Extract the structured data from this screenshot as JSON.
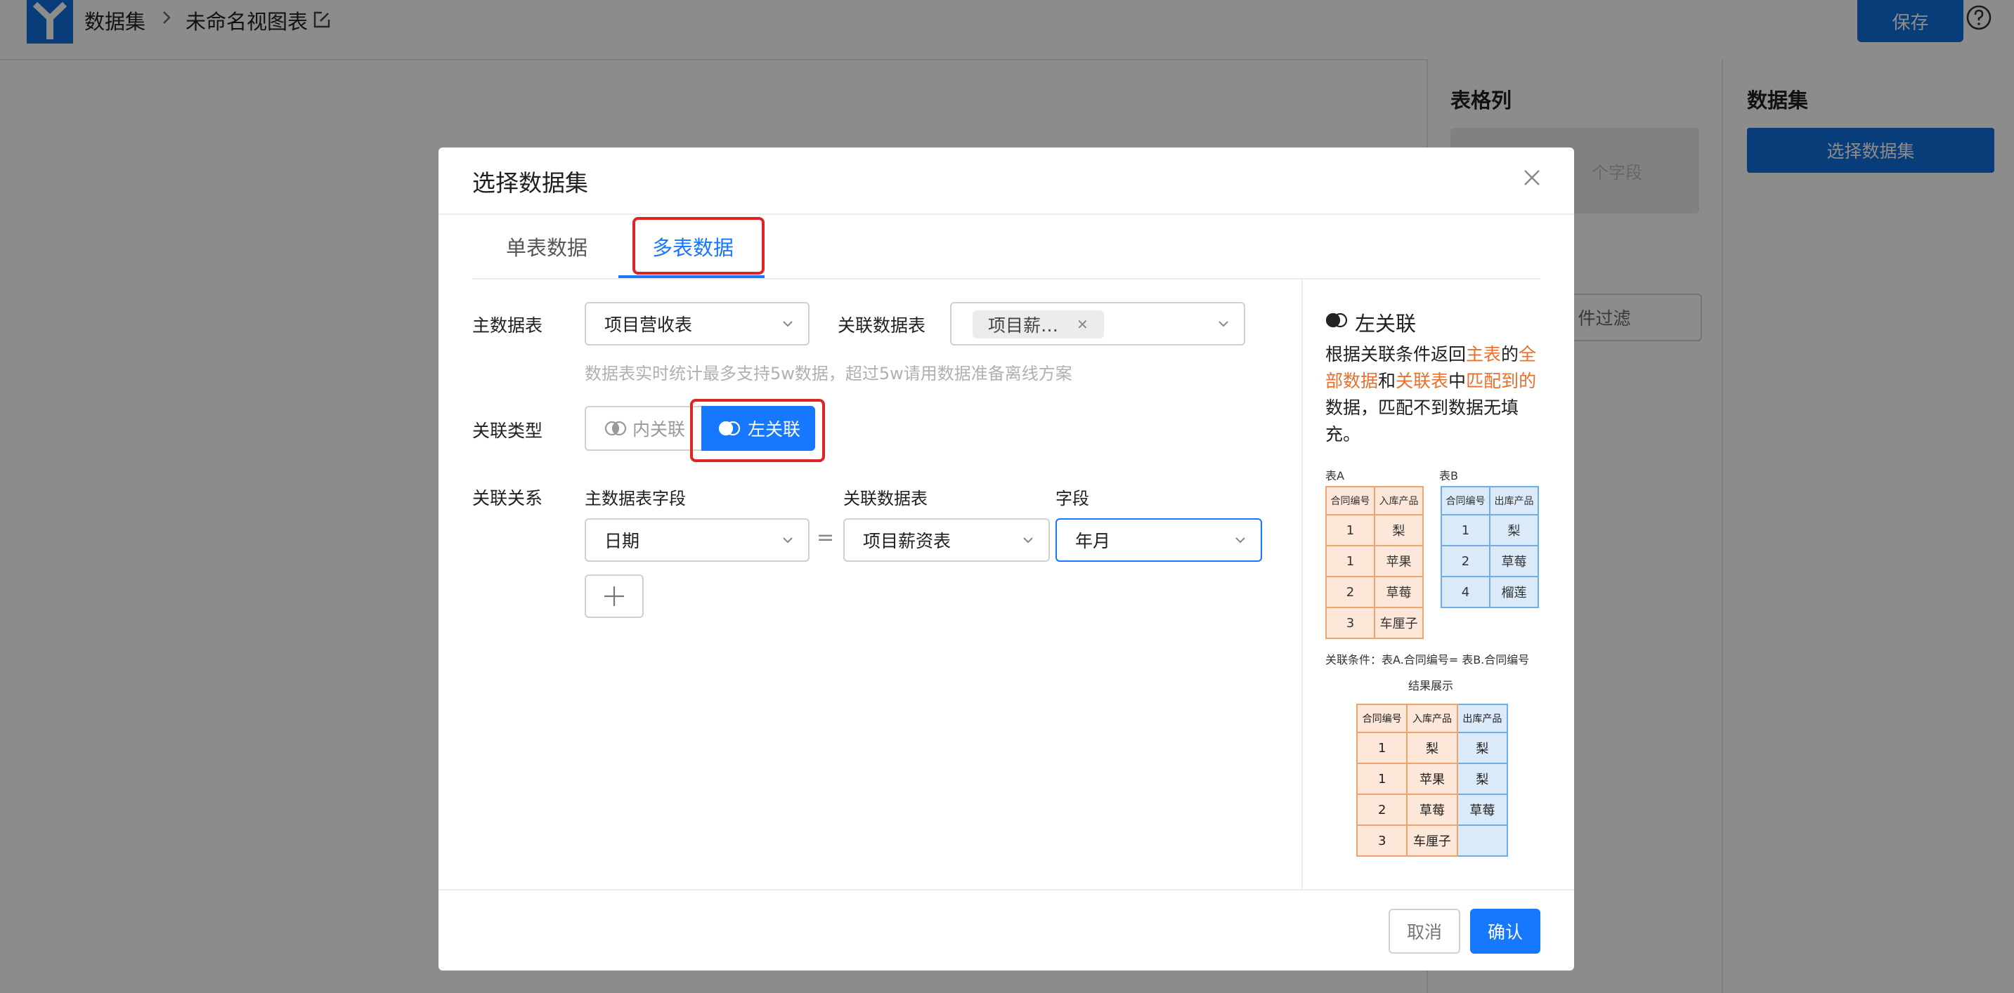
{
  "app": {
    "breadcrumb": [
      "数据集",
      "未命名视图表"
    ],
    "save_label": "保存",
    "colors": {
      "primary": "#1677ff",
      "save": "#0f6fdf",
      "highlight": "#e8702a",
      "annotation": "#e02424"
    }
  },
  "background_panels": {
    "table_columns_title": "表格列",
    "drop_placeholder": "个字段",
    "filter_label": "件过滤",
    "dataset_title": "数据集",
    "choose_dataset_label": "选择数据集"
  },
  "modal": {
    "title": "选择数据集",
    "tabs": [
      {
        "label": "单表数据",
        "active": false
      },
      {
        "label": "多表数据",
        "active": true
      }
    ],
    "main_table_label": "主数据表",
    "main_table_value": "项目营收表",
    "related_table_label": "关联数据表",
    "related_table_tag": "项目薪…",
    "hint": "数据表实时统计最多支持5w数据，超过5w请用数据准备离线方案",
    "join_type_label": "关联类型",
    "join_types": [
      {
        "label": "内关联",
        "selected": false
      },
      {
        "label": "左关联",
        "selected": true
      }
    ],
    "relation_label": "关联关系",
    "relation_headers": {
      "main_field": "主数据表字段",
      "related_table": "关联数据表",
      "field": "字段"
    },
    "relation_row": {
      "main_field": "日期",
      "operator": "=",
      "related_table": "项目薪资表",
      "field": "年月"
    },
    "cancel_label": "取消",
    "confirm_label": "确认"
  },
  "info_panel": {
    "title": "左关联",
    "desc": {
      "p1": "根据关联条件返回",
      "h1": "主表",
      "p2": "的",
      "h2": "全部数据",
      "p3": "和",
      "h3": "关联表",
      "p4": "中",
      "h4": "匹配到的",
      "p5": "数据，匹配不到数据无填充。"
    },
    "table_a_caption": "表A",
    "table_b_caption": "表B",
    "table_a": {
      "headers": [
        "合同编号",
        "入库产品"
      ],
      "rows": [
        [
          "1",
          "梨"
        ],
        [
          "1",
          "苹果"
        ],
        [
          "2",
          "草莓"
        ],
        [
          "3",
          "车厘子"
        ]
      ]
    },
    "table_b": {
      "headers": [
        "合同编号",
        "出库产品"
      ],
      "rows": [
        [
          "1",
          "梨"
        ],
        [
          "2",
          "草莓"
        ],
        [
          "4",
          "榴莲"
        ]
      ]
    },
    "condition": "关联条件：表A.合同编号= 表B.合同编号",
    "result_caption": "结果展示",
    "result": {
      "headers": [
        "合同编号",
        "入库产品",
        "出库产品"
      ],
      "rows": [
        [
          "1",
          "梨",
          "梨"
        ],
        [
          "1",
          "苹果",
          "梨"
        ],
        [
          "2",
          "草莓",
          "草莓"
        ],
        [
          "3",
          "车厘子",
          ""
        ]
      ]
    }
  }
}
